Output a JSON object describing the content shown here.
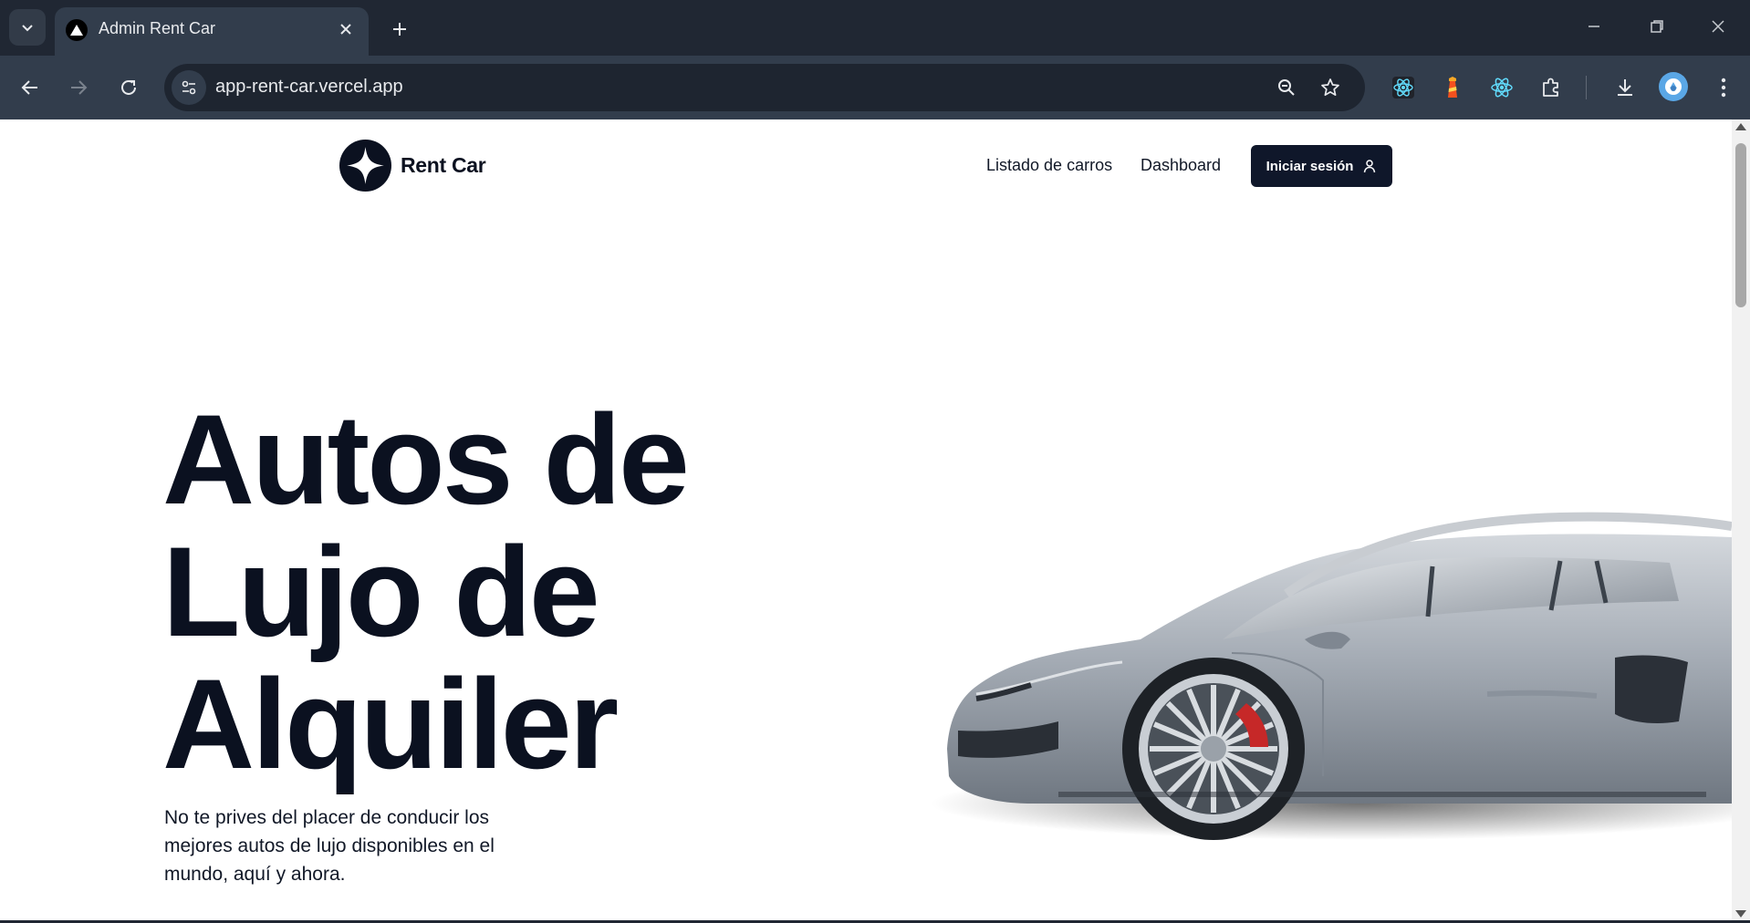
{
  "browser": {
    "tab_title": "Admin Rent Car",
    "url": "app-rent-car.vercel.app",
    "icons": [
      "tab-search-icon",
      "close-icon",
      "plus-icon",
      "minimize-icon",
      "restore-icon",
      "close-window-icon",
      "back-icon",
      "forward-icon",
      "reload-icon",
      "site-info-icon",
      "zoom-icon",
      "star-icon",
      "react-devtools-icon",
      "lighthouse-icon",
      "react-icon",
      "extensions-icon",
      "download-icon",
      "profile-icon",
      "menu-icon"
    ]
  },
  "site": {
    "logo_text": "Rent Car",
    "nav": {
      "listado": "Listado de carros",
      "dashboard": "Dashboard",
      "login": "Iniciar sesión"
    },
    "hero": {
      "title_line1": "Autos de",
      "title_line2": "Lujo de",
      "title_line3": "Alquiler",
      "subtitle": "No te prives del placer de conducir los mejores autos de lujo disponibles en el mundo, aquí y ahora."
    }
  },
  "colors": {
    "chrome_bg": "#202733",
    "toolbar_bg": "#323d4c",
    "primary_dark": "#0f172a",
    "car_silver": "#9aa3ad"
  }
}
